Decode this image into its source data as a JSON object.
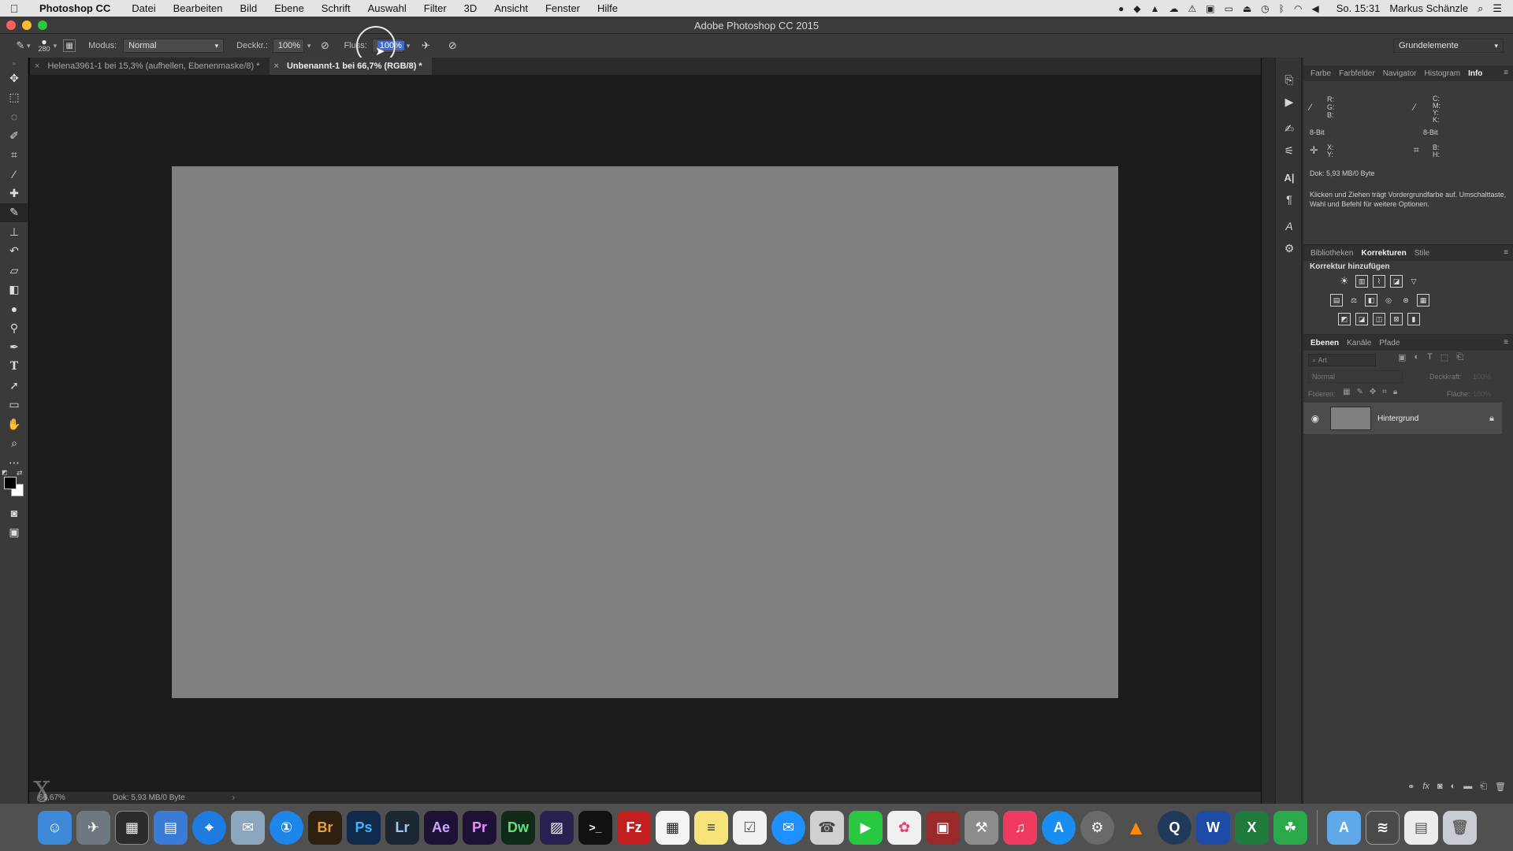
{
  "menubar": {
    "app_name": "Photoshop CC",
    "items": [
      "Datei",
      "Bearbeiten",
      "Bild",
      "Ebene",
      "Schrift",
      "Auswahl",
      "Filter",
      "3D",
      "Ansicht",
      "Fenster",
      "Hilfe"
    ],
    "clock": "So. 15:31",
    "user": "Markus Schänzle"
  },
  "window": {
    "title": "Adobe Photoshop CC 2015"
  },
  "options_bar": {
    "brush_size": "280",
    "mode_label": "Modus:",
    "mode_value": "Normal",
    "opacity_label": "Deckkr.:",
    "opacity_value": "100%",
    "flow_label": "Fluss:",
    "flow_value": "100%",
    "workspace": "Grundelemente"
  },
  "tabs": [
    {
      "label": "Helena3961-1 bei 15,3% (aufhellen, Ebenenmaske/8) *",
      "active": false
    },
    {
      "label": "Unbenannt-1 bei 66,7% (RGB/8) *",
      "active": true
    }
  ],
  "status": {
    "zoom": "66,67%",
    "doc": "Dok: 5,93 MB/0 Byte",
    "arrow": "›"
  },
  "info_panel": {
    "tabs": [
      "Farbe",
      "Farbfelder",
      "Navigator",
      "Histogram",
      "Info"
    ],
    "active": "Info",
    "rgb_labels": [
      "R:",
      "G:",
      "B:"
    ],
    "cmyk_labels": [
      "C:",
      "M:",
      "Y:",
      "K:"
    ],
    "bit_left": "8-Bit",
    "bit_right": "8-Bit",
    "xy_labels": [
      "X:",
      "Y:"
    ],
    "bh_labels": [
      "B:",
      "H:"
    ],
    "doc": "Dok: 5,93 MB/0 Byte",
    "hint": "Klicken und Ziehen trägt Vordergrundfarbe auf. Umschalttaste, Wahl und Befehl für weitere Optionen."
  },
  "adjustments_panel": {
    "tabs": [
      "Bibliotheken",
      "Korrekturen",
      "Stile"
    ],
    "active": "Korrekturen",
    "heading": "Korrektur hinzufügen"
  },
  "layers_panel": {
    "tabs": [
      "Ebenen",
      "Kanäle",
      "Pfade"
    ],
    "active": "Ebenen",
    "filter_placeholder": "Art",
    "blend_mode": "Normal",
    "opacity_label": "Deckkraft:",
    "opacity_value": "100%",
    "lock_label": "Fixieren:",
    "fill_label": "Fläche:",
    "fill_value": "100%",
    "layer_name": "Hintergrund"
  },
  "colors": {
    "canvas": "#808080",
    "foreground": "#000000",
    "background": "#ffffff",
    "flow_highlight": "#3d6ad6"
  }
}
